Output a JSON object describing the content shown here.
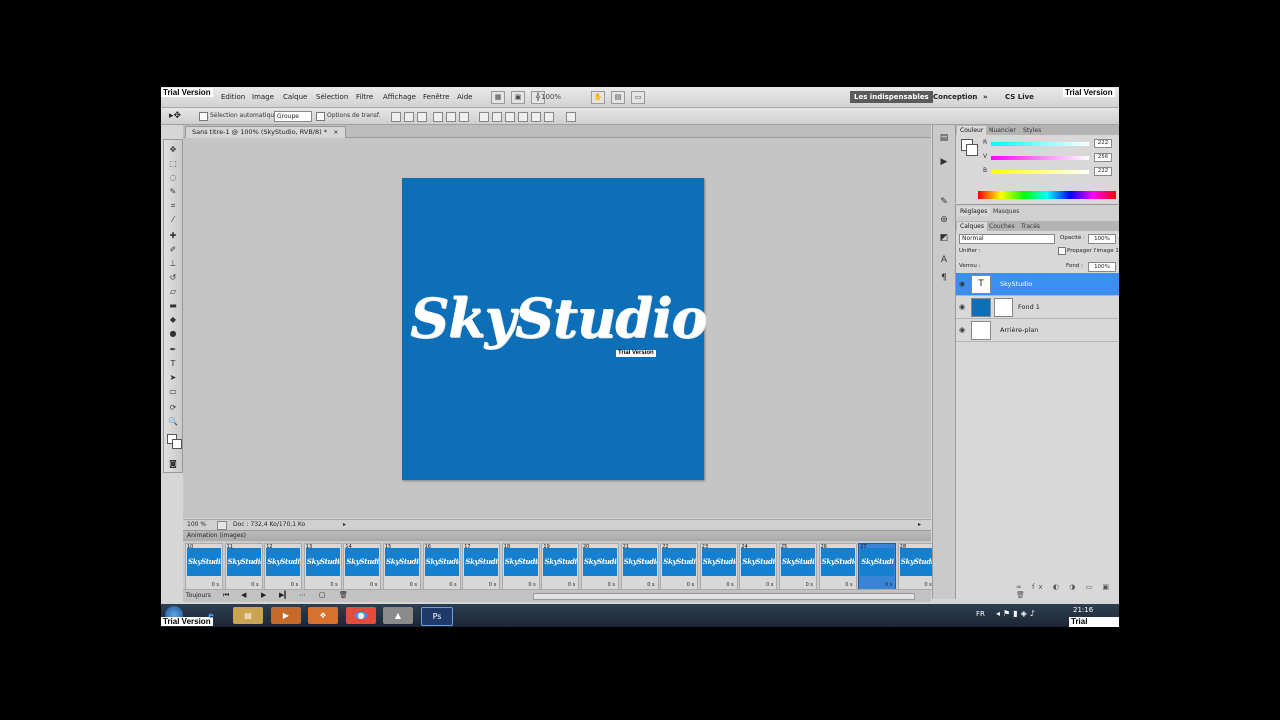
{
  "watermark": "Trial Version",
  "menu": {
    "items": [
      "Edition",
      "Image",
      "Calque",
      "Sélection",
      "Filtre",
      "Affichage",
      "Fenêtre",
      "Aide"
    ],
    "zoom": "100%",
    "workspace_essentials": "Les indispensables",
    "workspace_design": "Conception",
    "more": "»",
    "cs_live": "CS Live"
  },
  "options": {
    "auto_select_label": "Sélection automatique :",
    "auto_select_value": "Groupe",
    "transform_label": "Options de transf."
  },
  "document": {
    "tab_title": "Sans titre-1 @ 100% (SkyStudio, RVB/8) *",
    "close": "×"
  },
  "canvas": {
    "background": "#0c6fb8",
    "logo_text": "SkyStudio"
  },
  "status": {
    "zoom": "100 %",
    "doc_size": "Doc : 732,4 Ko/170,1 Ko"
  },
  "animation": {
    "title": "Animation (images)",
    "frames": [
      {
        "number": "10",
        "delay": "0 s"
      },
      {
        "number": "11",
        "delay": "0 s"
      },
      {
        "number": "12",
        "delay": "0 s"
      },
      {
        "number": "13",
        "delay": "0 s"
      },
      {
        "number": "14",
        "delay": "0 s"
      },
      {
        "number": "15",
        "delay": "0 s"
      },
      {
        "number": "16",
        "delay": "0 s"
      },
      {
        "number": "17",
        "delay": "0 s"
      },
      {
        "number": "18",
        "delay": "0 s"
      },
      {
        "number": "19",
        "delay": "0 s"
      },
      {
        "number": "20",
        "delay": "0 s"
      },
      {
        "number": "21",
        "delay": "0 s"
      },
      {
        "number": "22",
        "delay": "0 s"
      },
      {
        "number": "23",
        "delay": "0 s"
      },
      {
        "number": "24",
        "delay": "0 s"
      },
      {
        "number": "25",
        "delay": "0 s"
      },
      {
        "number": "26",
        "delay": "0 s"
      },
      {
        "number": "27",
        "delay": "0 s",
        "selected": true
      },
      {
        "number": "28",
        "delay": "0 s"
      }
    ],
    "loop": "Toujours"
  },
  "color_panel": {
    "tabs": [
      "Couleur",
      "Nuancier",
      "Styles"
    ],
    "r_label": "R",
    "v_label": "V",
    "b_label": "B",
    "r_value": "222",
    "v_value": "256",
    "b_value": "222"
  },
  "adjust_panel": {
    "tabs": [
      "Réglages",
      "Masques"
    ]
  },
  "layers_panel": {
    "tabs": [
      "Calques",
      "Couches",
      "Tracés"
    ],
    "blend_mode": "Normal",
    "opacity_label": "Opacité :",
    "opacity_value": "100%",
    "unify_label": "Unifier :",
    "propagate_label": "Propager l'image 1",
    "lock_label": "Verrou :",
    "fill_label": "Fond :",
    "fill_value": "100%",
    "layers": [
      {
        "name": "SkyStudio",
        "thumb": "T",
        "selected": true
      },
      {
        "name": "Fond 1",
        "thumb": ""
      },
      {
        "name": "Arrière-plan",
        "thumb": ""
      }
    ]
  },
  "taskbar": {
    "language": "FR",
    "time": "21:16"
  }
}
